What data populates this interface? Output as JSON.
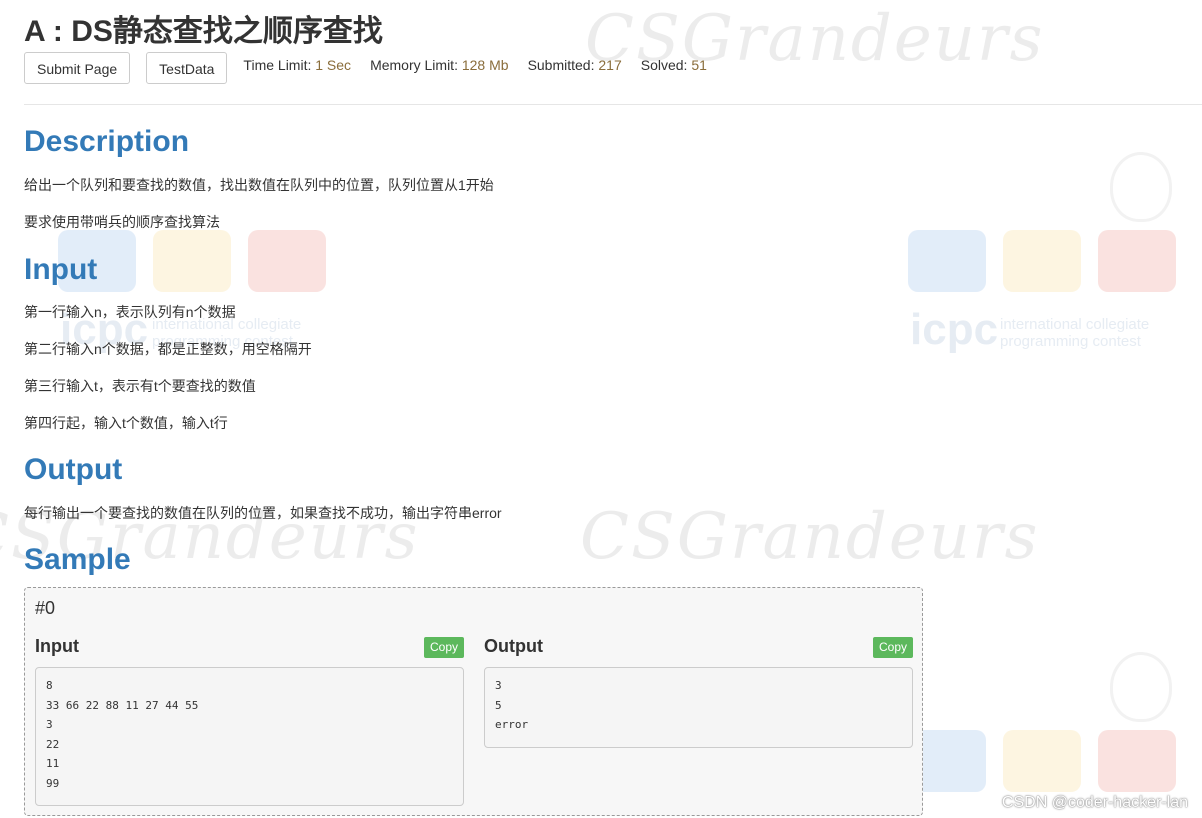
{
  "problem": {
    "title": "A : DS静态查找之顺序查找",
    "buttons": {
      "submit": "Submit Page",
      "testdata": "TestData"
    },
    "stats": [
      {
        "label": "Time Limit:",
        "value": "1 Sec"
      },
      {
        "label": "Memory Limit:",
        "value": "128 Mb"
      },
      {
        "label": "Submitted:",
        "value": "217"
      },
      {
        "label": "Solved:",
        "value": "51"
      }
    ]
  },
  "description": {
    "heading": "Description",
    "lines": [
      "给出一个队列和要查找的数值，找出数值在队列中的位置，队列位置从1开始",
      "要求使用带哨兵的顺序查找算法"
    ]
  },
  "input": {
    "heading": "Input",
    "lines": [
      "第一行输入n，表示队列有n个数据",
      "第二行输入n个数据，都是正整数，用空格隔开",
      "第三行输入t，表示有t个要查找的数值",
      "第四行起，输入t个数值，输入t行"
    ]
  },
  "output": {
    "heading": "Output",
    "lines": [
      "每行输出一个要查找的数值在队列的位置，如果查找不成功，输出字符串error"
    ]
  },
  "sample": {
    "heading": "Sample",
    "case_label": "#0",
    "input_title": "Input",
    "output_title": "Output",
    "copy_label": "Copy",
    "input_text": "8\n33 66 22 88 11 27 44 55\n3\n22\n11\n99",
    "output_text": "3\n5\nerror"
  },
  "watermarks": {
    "brand": "CSGrandeurs",
    "icpc": "icpc",
    "icpc_sub": "international collegiate\nprogramming contest",
    "csdn": "CSDN @coder-hacker-lan"
  }
}
